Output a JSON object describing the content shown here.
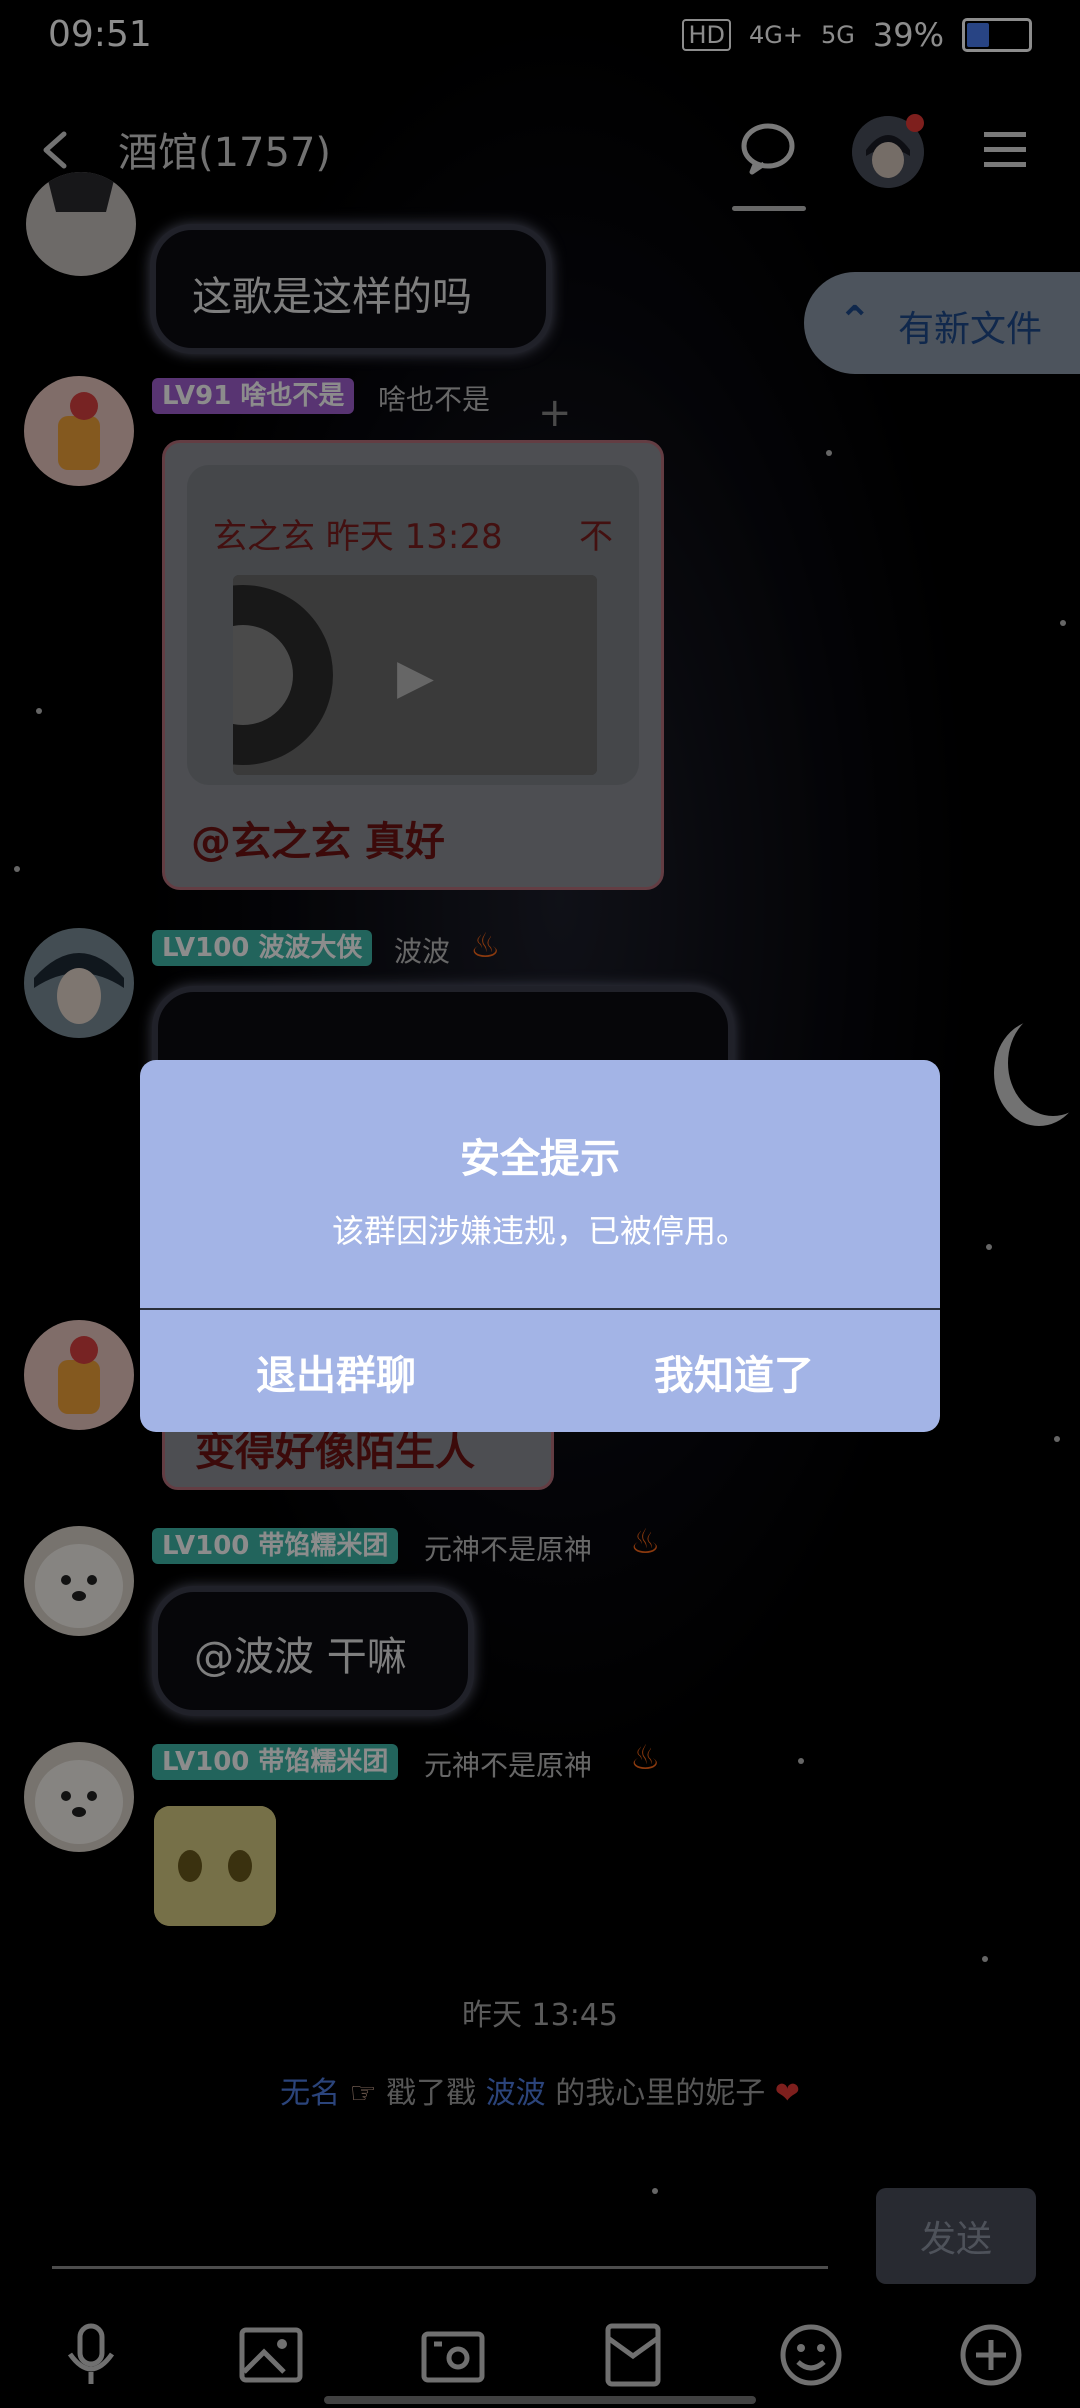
{
  "status_bar": {
    "time": "09:51",
    "network": "4G+",
    "network2": "5G",
    "battery": "39%"
  },
  "header": {
    "back": "‹",
    "title": "酒馆(1757)"
  },
  "new_file_pill": {
    "label": "有新文件"
  },
  "messages": {
    "m1_text": "这歌是这样的吗",
    "m2_badge": "LV91 啥也不是",
    "m2_nick": "啥也不是",
    "m2_quote_author": "玄之玄 昨天 13:28",
    "m2_quote_tail": "不",
    "m2_text": "@玄之玄 真好",
    "m3_badge": "LV100 波波大侠",
    "m3_nick": "波波",
    "m4_text_partial": "变得好像陌生人",
    "m5_badge": "LV100 带馅糯米团",
    "m5_nick": "元神不是原神",
    "m5_text": "@波波 干嘛",
    "m6_badge": "LV100 带馅糯米团",
    "m6_nick": "元神不是原神"
  },
  "dialog": {
    "title": "安全提示",
    "message": "该群因涉嫌违规，已被停用。",
    "exit_label": "退出群聊",
    "ok_label": "我知道了"
  },
  "time_chip": "昨天 13:45",
  "system_msg": {
    "actor": "无名",
    "action": "戳了戳",
    "target": "波波",
    "rest": "的我心里的妮子"
  },
  "composer": {
    "send_label": "发送"
  },
  "colors": {
    "dialog_bg": "#a3b4e6",
    "badge_purple": "#a05fcf",
    "badge_teal": "#3fb6a8"
  }
}
